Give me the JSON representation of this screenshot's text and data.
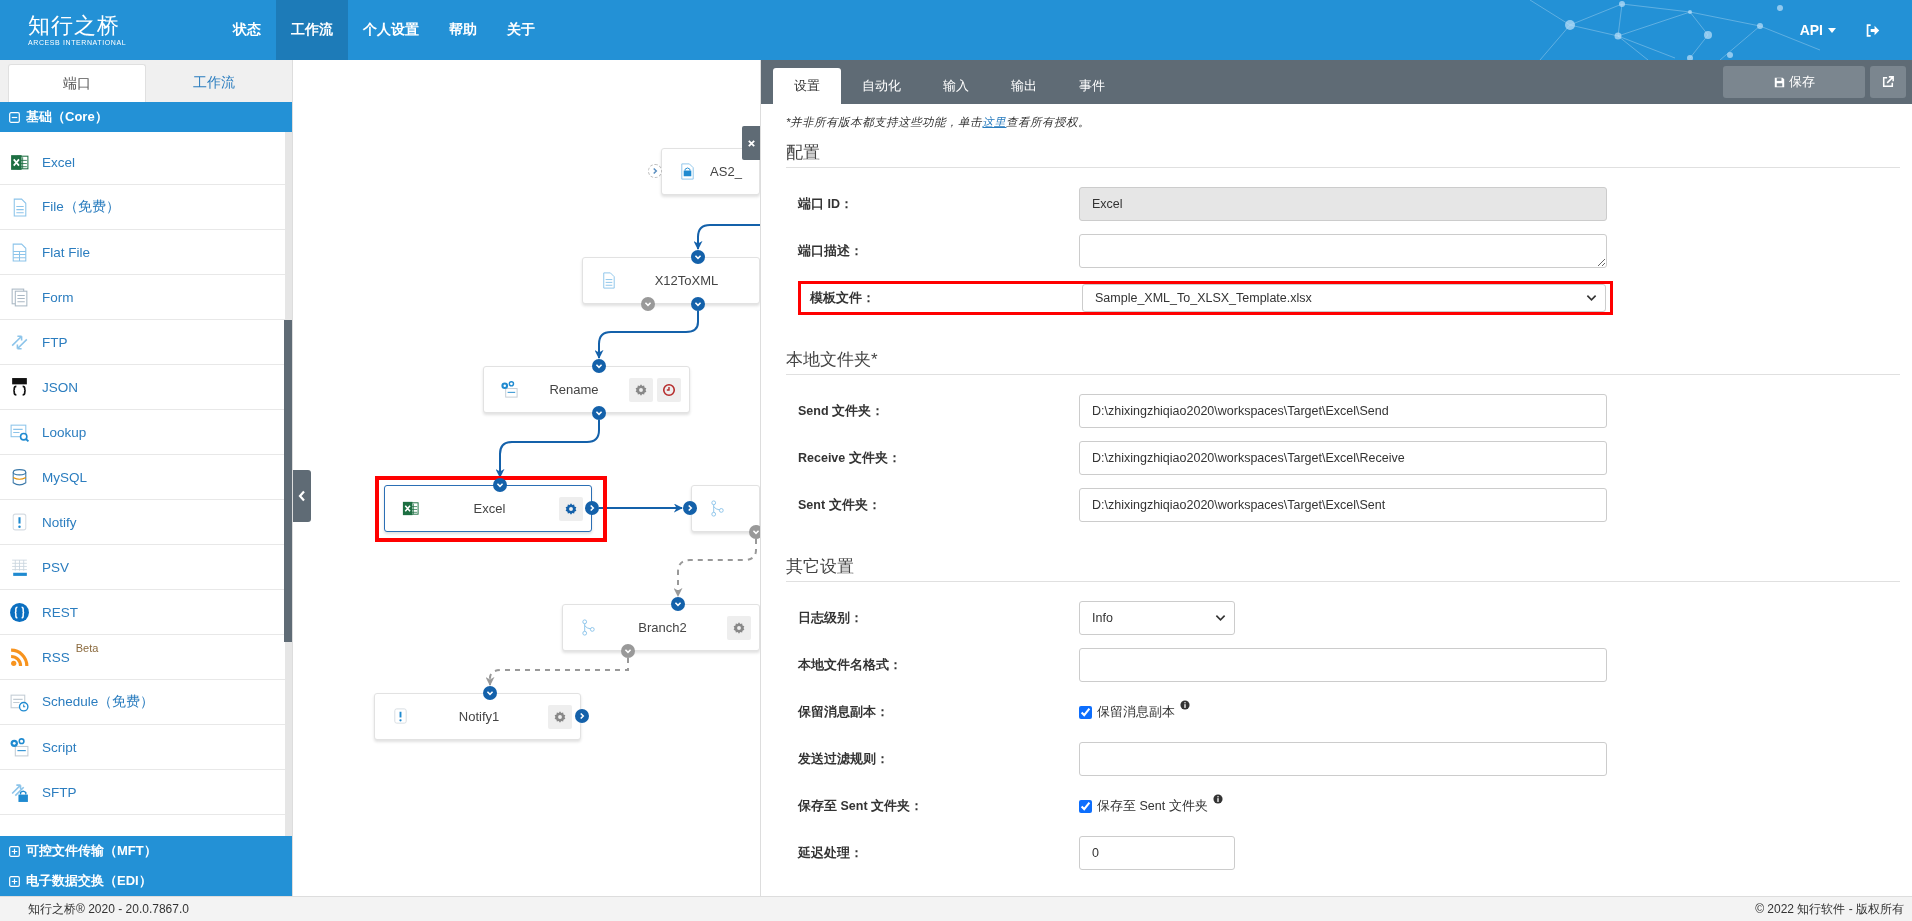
{
  "header": {
    "logo": {
      "name": "知行之桥",
      "tagline": "ARCESB INTERNATIONAL"
    },
    "nav": [
      {
        "label": "状态",
        "selected": false
      },
      {
        "label": "工作流",
        "selected": true
      },
      {
        "label": "个人设置",
        "selected": false
      },
      {
        "label": "帮助",
        "selected": false
      },
      {
        "label": "关于",
        "selected": false
      }
    ],
    "api_menu": "API"
  },
  "sidebar": {
    "tabs": [
      {
        "label": "端口",
        "selected": true
      },
      {
        "label": "工作流",
        "selected": false
      }
    ],
    "sections": [
      {
        "label": "基础（Core）",
        "expanded": true,
        "items": [
          {
            "label": "Excel",
            "kind": "spreadsheet"
          },
          {
            "label": "File（免费）",
            "kind": "document"
          },
          {
            "label": "Flat File",
            "kind": "table-document"
          },
          {
            "label": "Form",
            "kind": "forms"
          },
          {
            "label": "FTP",
            "kind": "transfer"
          },
          {
            "label": "JSON",
            "kind": "braces"
          },
          {
            "label": "Lookup",
            "kind": "search-document"
          },
          {
            "label": "MySQL",
            "kind": "database"
          },
          {
            "label": "Notify",
            "kind": "alert"
          },
          {
            "label": "PSV",
            "kind": "grid-document"
          },
          {
            "label": "REST",
            "kind": "braces-circle"
          },
          {
            "label": "RSS",
            "kind": "rss",
            "badge": "Beta"
          },
          {
            "label": "Schedule（免费）",
            "kind": "calendar-clock"
          },
          {
            "label": "Script",
            "kind": "gears"
          },
          {
            "label": "SFTP",
            "kind": "lock-transfer"
          }
        ]
      },
      {
        "label": "可控文件传输（MFT）",
        "expanded": false
      },
      {
        "label": "电子数据交换（EDI）",
        "expanded": false
      }
    ]
  },
  "canvas": {
    "nodes": [
      {
        "label": "AS2_",
        "kind": "lock-document",
        "selected": false,
        "highlighted": false
      },
      {
        "label": "X12ToXML",
        "kind": "document",
        "selected": false,
        "highlighted": false
      },
      {
        "label": "Rename",
        "kind": "gears",
        "selected": false,
        "highlighted": false
      },
      {
        "label": "Excel",
        "kind": "spreadsheet",
        "selected": true,
        "highlighted": true
      },
      {
        "kind": "branch",
        "selected": false,
        "highlighted": false
      },
      {
        "label": "Branch2",
        "kind": "branch",
        "selected": false,
        "highlighted": false
      },
      {
        "label": "Notify1",
        "kind": "alert",
        "selected": false,
        "highlighted": false
      }
    ]
  },
  "panel": {
    "tabs": [
      {
        "label": "设置",
        "selected": true
      },
      {
        "label": "自动化",
        "selected": false
      },
      {
        "label": "输入",
        "selected": false
      },
      {
        "label": "输出",
        "selected": false
      },
      {
        "label": "事件",
        "selected": false
      }
    ],
    "save_button": "保存",
    "note": {
      "before": "*并非所有版本都支持这些功能，单击",
      "link": "这里",
      "after": "查看所有授权。"
    },
    "sections": [
      {
        "title": "配置",
        "fields": [
          {
            "label": "端口 ID：",
            "kind": "text",
            "value": "Excel",
            "disabled": true,
            "highlighted": false
          },
          {
            "label": "端口描述：",
            "kind": "textarea",
            "disabled": false,
            "highlighted": false
          },
          {
            "label": "模板文件：",
            "kind": "select",
            "value": "Sample_XML_To_XLSX_Template.xlsx",
            "disabled": false,
            "highlighted": true
          }
        ]
      },
      {
        "title": "本地文件夹*",
        "fields": [
          {
            "label": "Send 文件夹：",
            "kind": "text",
            "value": "D:\\zhixingzhiqiao2020\\workspaces\\Target\\Excel\\Send",
            "disabled": false,
            "highlighted": false
          },
          {
            "label": "Receive 文件夹：",
            "kind": "text",
            "value": "D:\\zhixingzhiqiao2020\\workspaces\\Target\\Excel\\Receive",
            "disabled": false,
            "highlighted": false
          },
          {
            "label": "Sent 文件夹：",
            "kind": "text",
            "value": "D:\\zhixingzhiqiao2020\\workspaces\\Target\\Excel\\Sent",
            "disabled": false,
            "highlighted": false
          }
        ]
      },
      {
        "title": "其它设置",
        "fields": [
          {
            "label": "日志级别：",
            "kind": "level-select",
            "value": "Info",
            "disabled": false,
            "highlighted": false
          },
          {
            "label": "本地文件名格式：",
            "kind": "text",
            "disabled": false,
            "highlighted": false
          },
          {
            "label": "保留消息副本：",
            "kind": "checkbox",
            "text": "保留消息副本",
            "checked": true,
            "disabled": false,
            "highlighted": false
          },
          {
            "label": "发送过滤规则：",
            "kind": "text",
            "disabled": false,
            "highlighted": false
          },
          {
            "label": "保存至 Sent 文件夹：",
            "kind": "checkbox",
            "text": "保存至 Sent 文件夹",
            "checked": true,
            "disabled": false,
            "highlighted": false
          },
          {
            "label": "延迟处理：",
            "kind": "number",
            "value": "0",
            "disabled": false,
            "highlighted": false
          }
        ]
      }
    ]
  },
  "footer": {
    "version": "知行之桥® 2020 - 20.0.7867.0",
    "copyright": "© 2022 知行软件 - 版权所有"
  }
}
